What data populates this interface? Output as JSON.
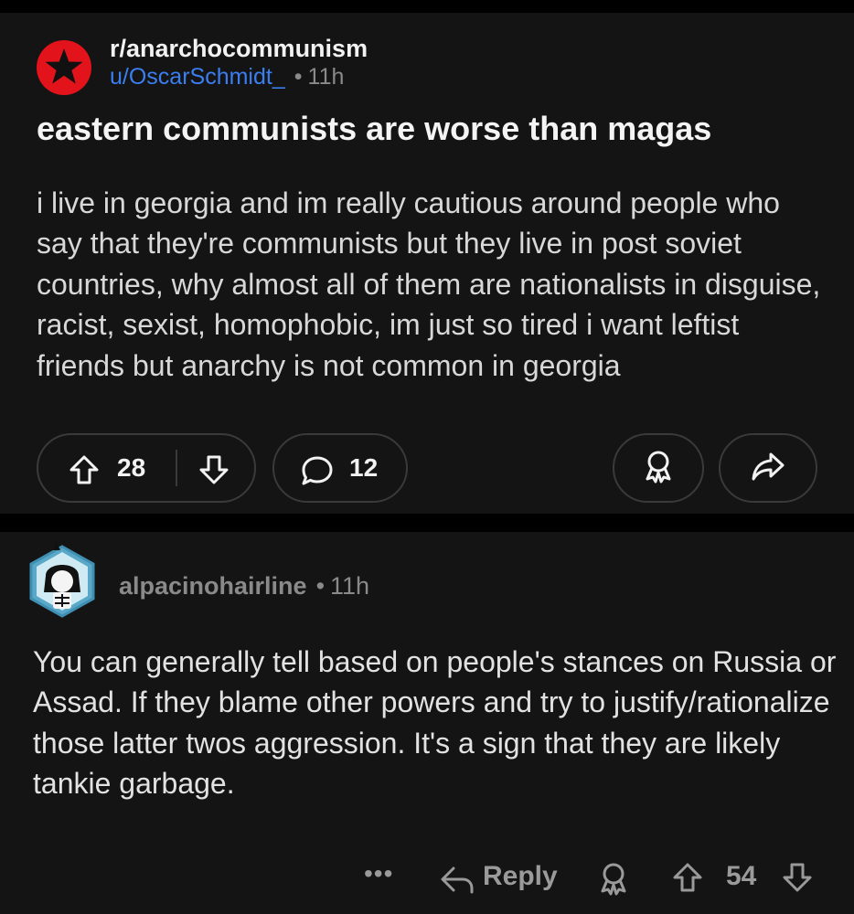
{
  "post": {
    "subreddit": "r/anarchocommunism",
    "subreddit_icon": "red-circle-black-star-icon",
    "author": "u/OscarSchmidt_",
    "separator": "•",
    "age": "11h",
    "title": "eastern communists are worse than magas",
    "body": "i live in georgia and im really cautious around people who say that they're communists but they live in post soviet countries, why almost all of them are nationalists in disguise, racist, sexist, homophobic, im just so tired i want leftist friends but anarchy is not common in georgia",
    "votes": "28",
    "comments": "12"
  },
  "comment": {
    "username": "alpacinohairline",
    "separator": "•",
    "age": "11h",
    "body": "You can generally tell based on people's stances on Russia or Assad. If they blame other powers and try to justify/rationalize those latter twos aggression. It's a sign that they are likely tankie garbage.",
    "more_label": "•••",
    "reply_label": "Reply",
    "votes": "54"
  },
  "colors": {
    "background": "#000000",
    "card": "#141414",
    "author_link": "#3b7ef0",
    "muted": "#8a8a8a",
    "subreddit_icon": "#e3131b"
  }
}
